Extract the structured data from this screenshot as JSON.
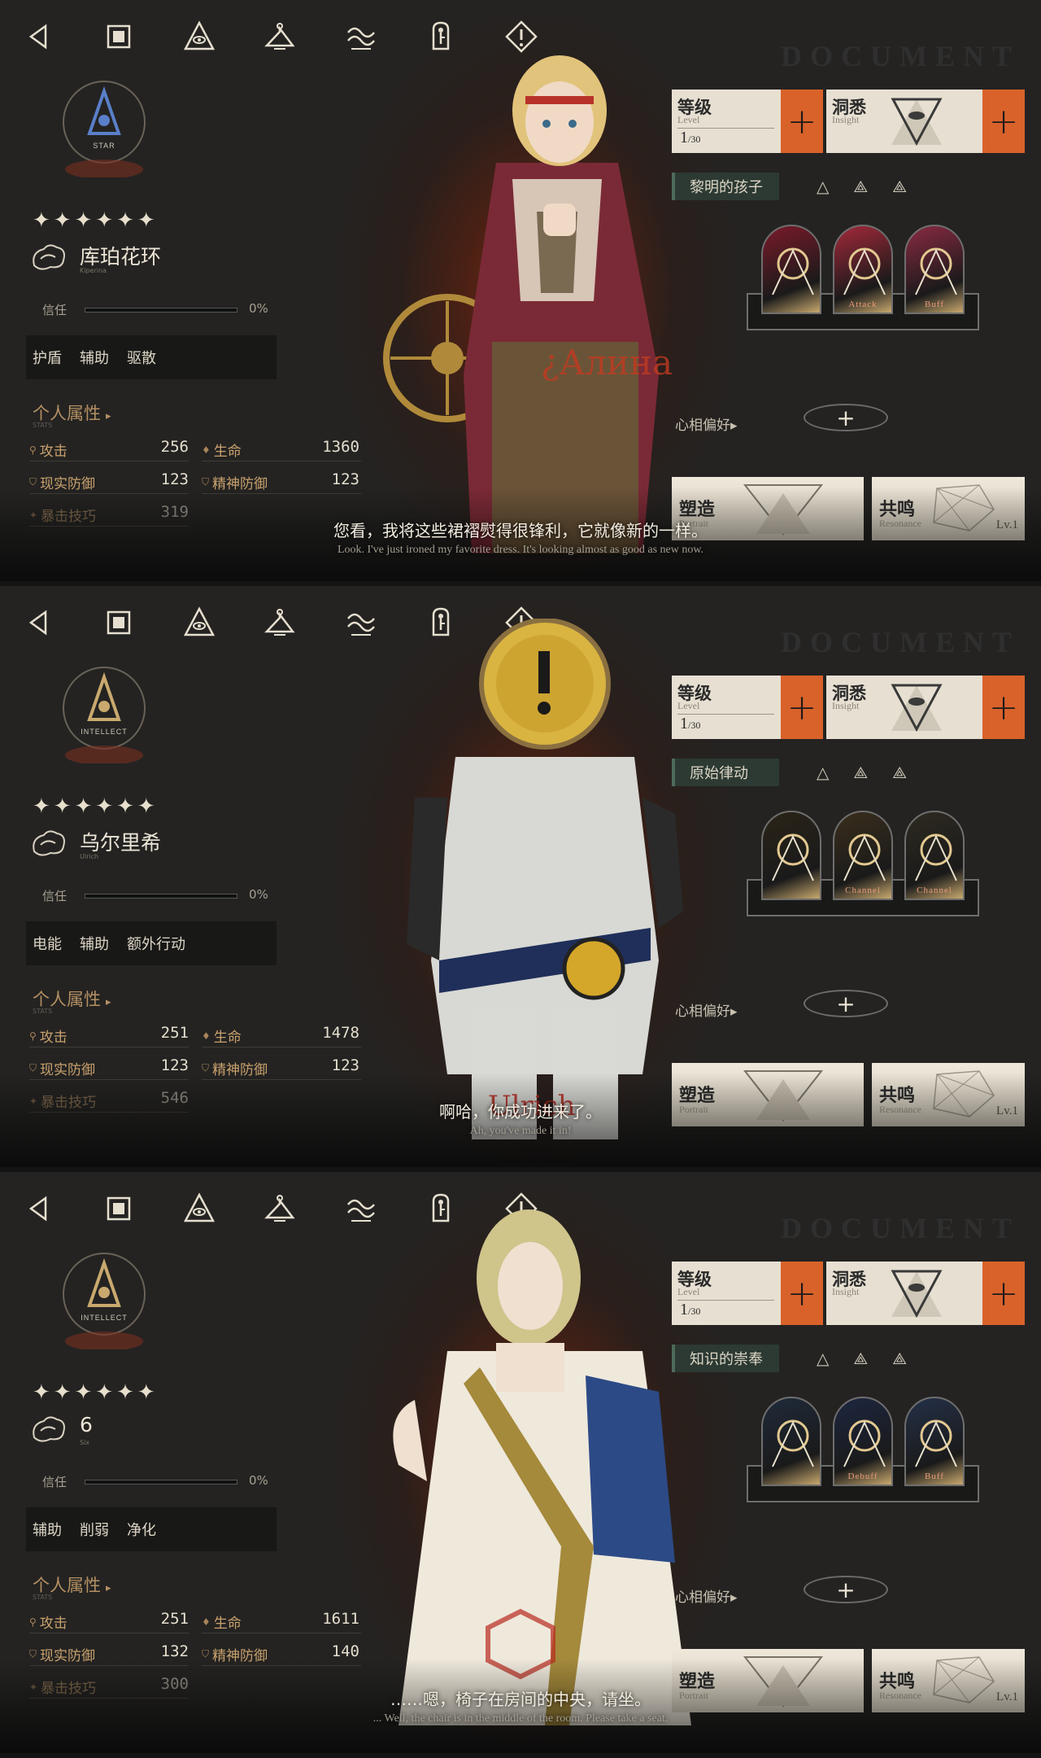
{
  "document_watermark": "DOCUMENT",
  "toolbar": [
    "back-icon",
    "stop-icon",
    "eye-triangle-icon",
    "hanger-icon",
    "wave-icon",
    "key-icon",
    "alert-icon"
  ],
  "labels": {
    "trust": "信任",
    "attr_head": "个人属性",
    "attr_sub": "STATS",
    "atk": "攻击",
    "hp": "生命",
    "rdef": "现实防御",
    "mdef": "精神防御",
    "crit": "暴击技巧",
    "level": "等级",
    "level_en": "Level",
    "insight": "洞悉",
    "insight_en": "Insight",
    "pref": "心相偏好",
    "portrait": "塑造",
    "portrait_en": "Portrait",
    "resonance": "共鸣",
    "resonance_en": "Resonance",
    "res_lv": "Lv.1",
    "lv_cur": "1",
    "lv_max": "30",
    "plus": "+",
    "tri_arrow": "▸",
    "pref_plus": "+"
  },
  "panels": [
    {
      "afflatus": "STAR",
      "afflatus_color": "#5a7fc9",
      "stars": "✦✦✦✦✦✦",
      "name": "库珀花环",
      "name_sub": "Kiperina",
      "trust_pct": "0%",
      "trust_fraction": 0,
      "tags": [
        "护盾",
        "辅助",
        "驱散"
      ],
      "atk": "256",
      "hp": "1360",
      "rdef": "123",
      "mdef": "123",
      "crit": "319",
      "path": "黎明的孩子",
      "skills": [
        {
          "cap": "",
          "color": "#7a1a2a"
        },
        {
          "cap": "Attack",
          "color": "#a3293a"
        },
        {
          "cap": "Buff",
          "color": "#8a2a42"
        }
      ],
      "sub_cn": "您看，我将这些裙褶熨得很锋利，它就像新的一样。",
      "sub_en": "Look. I've just ironed my favorite dress. It's looking almost as good as new now.",
      "char_theme": {
        "hair": "#e2c37b",
        "cloth": "#7a2a36",
        "accent": "#e8e0cc"
      }
    },
    {
      "afflatus": "INTELLECT",
      "afflatus_color": "#c9a96e",
      "stars": "✦✦✦✦✦✦",
      "name": "乌尔里希",
      "name_sub": "Ulrich",
      "trust_pct": "0%",
      "trust_fraction": 0,
      "tags": [
        "电能",
        "辅助",
        "额外行动"
      ],
      "atk": "251",
      "hp": "1478",
      "rdef": "123",
      "mdef": "123",
      "crit": "546",
      "path": "原始律动",
      "skills": [
        {
          "cap": "",
          "color": "#2a2418"
        },
        {
          "cap": "Channel",
          "color": "#3a2e1c"
        },
        {
          "cap": "Channel",
          "color": "#2e2a20"
        }
      ],
      "sub_cn": "啊哈，你成功进来了。",
      "sub_en": "Ah, you've made it in!",
      "char_theme": {
        "hair": "#d9b440",
        "cloth": "#d8d8d4",
        "accent": "#1f2f5a"
      }
    },
    {
      "afflatus": "INTELLECT",
      "afflatus_color": "#c9a96e",
      "stars": "✦✦✦✦✦✦",
      "name": "6",
      "name_sub": "Six",
      "trust_pct": "0%",
      "trust_fraction": 0,
      "tags": [
        "辅助",
        "削弱",
        "净化"
      ],
      "atk": "251",
      "hp": "1611",
      "rdef": "132",
      "mdef": "140",
      "crit": "300",
      "path": "知识的崇奉",
      "skills": [
        {
          "cap": "",
          "color": "#1f2a3a"
        },
        {
          "cap": "Debuff",
          "color": "#1c2640"
        },
        {
          "cap": "Buff",
          "color": "#243048"
        }
      ],
      "sub_cn": "……嗯，椅子在房间的中央，请坐。",
      "sub_en": "... Well, the chair is in the middle of the room. Please take a seat.",
      "char_theme": {
        "hair": "#cfc48a",
        "cloth": "#efe9dc",
        "accent": "#2c4a86"
      }
    }
  ]
}
